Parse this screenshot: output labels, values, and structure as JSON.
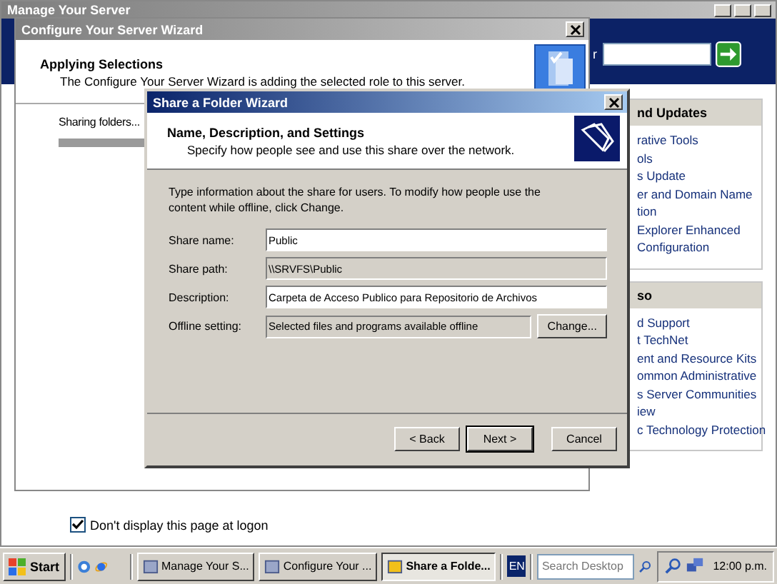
{
  "manage_server": {
    "title": "Manage Your Server",
    "search_label": "r",
    "panels": [
      {
        "heading": "nd Updates",
        "links": [
          "rative Tools",
          "ols",
          "s Update",
          "er and Domain Name",
          "tion",
          "Explorer Enhanced",
          "Configuration"
        ]
      },
      {
        "heading": "so",
        "links": [
          "d Support",
          "t TechNet",
          "ent and Resource Kits",
          "ommon Administrative",
          "s Server Communities",
          "iew",
          "c Technology Protection"
        ]
      }
    ],
    "logon_checkbox": {
      "label": "Don't display this page at logon",
      "checked": true
    }
  },
  "configure_wizard": {
    "title": "Configure Your Server Wizard",
    "heading": "Applying Selections",
    "subheading": "The Configure Your Server Wizard is adding the selected role to this server.",
    "status": "Sharing folders...",
    "progress": {
      "level": 0.3
    }
  },
  "share_wizard": {
    "title": "Share a Folder Wizard",
    "heading": "Name, Description, and Settings",
    "subheading": "Specify how people see and use this share over the network.",
    "intro": "Type information about the share for users. To modify how people use the content while offline, click Change.",
    "fields": [
      {
        "label": "Share name:",
        "value": "Public",
        "kind": "editable"
      },
      {
        "label": "Share path:",
        "value": "\\\\SRVFS\\Public",
        "kind": "readonly"
      },
      {
        "label": "Description:",
        "value": "Carpeta de Acceso Publico para Repositorio de Archivos",
        "kind": "editable"
      },
      {
        "label": "Offline setting:",
        "value": "Selected files and programs available offline",
        "kind": "readonly",
        "button": "Change..."
      }
    ],
    "buttons": [
      {
        "label": "< Back",
        "default": false
      },
      {
        "label": "Next >",
        "default": true
      },
      {
        "label": "Cancel",
        "default": false
      }
    ]
  },
  "taskbar": {
    "start": "Start",
    "tasks": [
      {
        "label": "Manage Your S...",
        "selected": false
      },
      {
        "label": "Configure Your ...",
        "selected": false
      },
      {
        "label": "Share a Folde...",
        "selected": true
      }
    ],
    "language": "EN",
    "search_placeholder": "Search Desktop",
    "clock": "12:00 p.m."
  }
}
